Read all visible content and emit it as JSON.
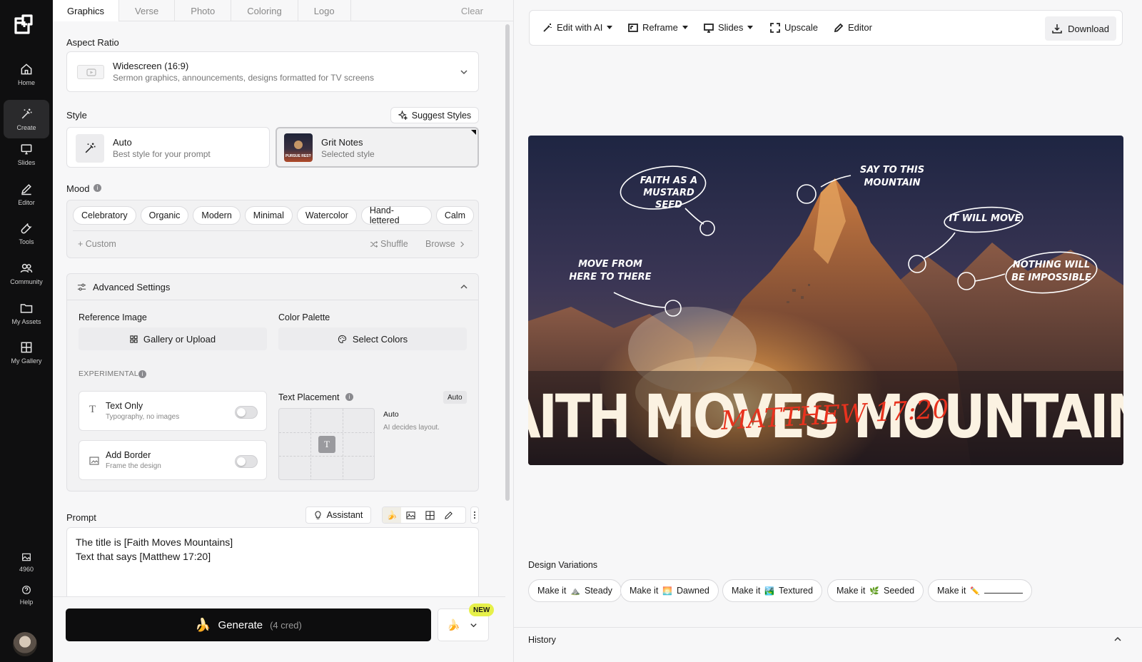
{
  "nav": {
    "items": [
      {
        "label": "Home",
        "icon": "home-icon"
      },
      {
        "label": "Create",
        "icon": "wand-icon",
        "active": true
      },
      {
        "label": "Slides",
        "icon": "slides-icon"
      },
      {
        "label": "Editor",
        "icon": "pencil-icon"
      },
      {
        "label": "Tools",
        "icon": "wrench-icon"
      },
      {
        "label": "Community",
        "icon": "users-icon"
      },
      {
        "label": "My Assets",
        "icon": "folder-icon"
      },
      {
        "label": "My Gallery",
        "icon": "grid-icon"
      }
    ],
    "credits": "4960",
    "help": "Help"
  },
  "tabs": [
    "Graphics",
    "Verse",
    "Photo",
    "Coloring",
    "Logo"
  ],
  "clear_label": "Clear",
  "aspect": {
    "label": "Aspect Ratio",
    "title": "Widescreen (16:9)",
    "desc": "Sermon graphics, announcements, designs formatted for TV screens"
  },
  "style": {
    "label": "Style",
    "suggest": "Suggest Styles",
    "auto_title": "Auto",
    "auto_desc": "Best style for your prompt",
    "sel_title": "Grit Notes",
    "sel_desc": "Selected style",
    "thumb_text": "PURSUE RESTORE"
  },
  "mood": {
    "label": "Mood",
    "pills": [
      "Celebratory",
      "Organic",
      "Modern",
      "Minimal",
      "Watercolor",
      "Hand-lettered",
      "Calm"
    ],
    "custom": "+ Custom",
    "shuffle": "Shuffle",
    "browse": "Browse"
  },
  "advanced": {
    "title": "Advanced Settings",
    "ref_label": "Reference Image",
    "ref_btn": "Gallery or Upload",
    "palette_label": "Color Palette",
    "palette_btn": "Select Colors",
    "experimental": "EXPERIMENTAL",
    "text_only_title": "Text Only",
    "text_only_desc": "Typography, no images",
    "border_title": "Add Border",
    "border_desc": "Frame the design",
    "placement_label": "Text Placement",
    "placement_badge": "Auto",
    "placement_title": "Auto",
    "placement_desc": "AI decides layout.",
    "placement_glyph": "T"
  },
  "prompt": {
    "label": "Prompt",
    "assistant": "Assistant",
    "line1": "The title is [Faith Moves Mountains]",
    "line2": "Text that says [Matthew 17:20]"
  },
  "generate": {
    "label": "Generate",
    "cred": "(4 cred)",
    "badge": "NEW"
  },
  "toolbar": {
    "edit": "Edit with AI",
    "reframe": "Reframe",
    "slides": "Slides",
    "upscale": "Upscale",
    "editor": "Editor",
    "download": "Download"
  },
  "design": {
    "title": "FAITH MOVES MOUNTAINS",
    "script": "MATTHEW 17:20",
    "notes": [
      "FAITH AS A",
      "MUSTARD SEED",
      "SAY TO THIS",
      "MOUNTAIN",
      "IT WILL MOVE",
      "MOVE FROM",
      "HERE TO THERE",
      "NOTHING WILL",
      "BE IMPOSSIBLE"
    ]
  },
  "variations": {
    "label": "Design Variations",
    "prefix": "Make it",
    "items": [
      {
        "emoji": "⛰️",
        "word": "Steady"
      },
      {
        "emoji": "🌅",
        "word": "Dawned"
      },
      {
        "emoji": "🏞️",
        "word": "Textured"
      },
      {
        "emoji": "🌿",
        "word": "Seeded"
      },
      {
        "emoji": "✏️",
        "word": ""
      }
    ]
  },
  "history": "History"
}
